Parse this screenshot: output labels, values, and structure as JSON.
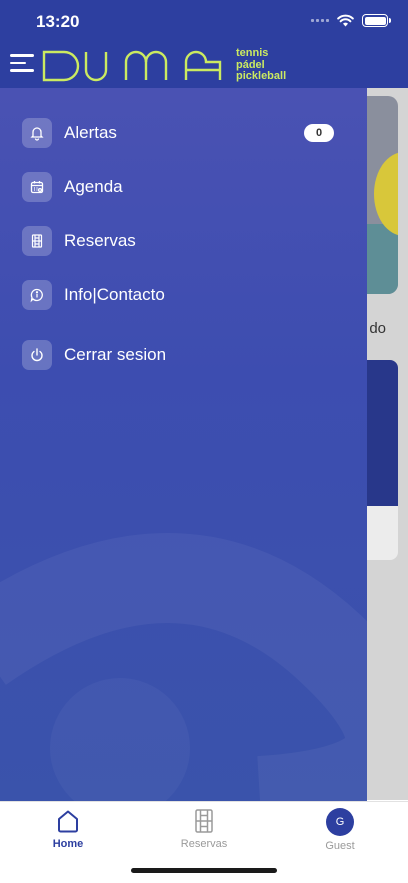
{
  "status_bar": {
    "time": "13:20"
  },
  "header": {
    "logo_text": "DUMA",
    "logo_subtitle": [
      "tennis",
      "pádel",
      "pickleball"
    ]
  },
  "background": {
    "partial_text": "do"
  },
  "drawer": {
    "items": [
      {
        "label": "Alertas",
        "icon": "bell-icon",
        "badge": "0"
      },
      {
        "label": "Agenda",
        "icon": "calendar-icon"
      },
      {
        "label": "Reservas",
        "icon": "court-icon"
      },
      {
        "label": "Info|Contacto",
        "icon": "chat-info-icon"
      },
      {
        "label": "Cerrar sesion",
        "icon": "power-icon"
      }
    ]
  },
  "tab_bar": {
    "tabs": [
      {
        "label": "Home",
        "icon": "home-icon",
        "active": true
      },
      {
        "label": "Reservas",
        "icon": "court-icon",
        "active": false
      },
      {
        "label": "Guest",
        "icon": "avatar",
        "avatar_initial": "G",
        "active": false
      }
    ]
  },
  "colors": {
    "brand_blue": "#2d3fa0",
    "logo_green": "#cbea61",
    "drawer_blue": "#4a52b3"
  }
}
